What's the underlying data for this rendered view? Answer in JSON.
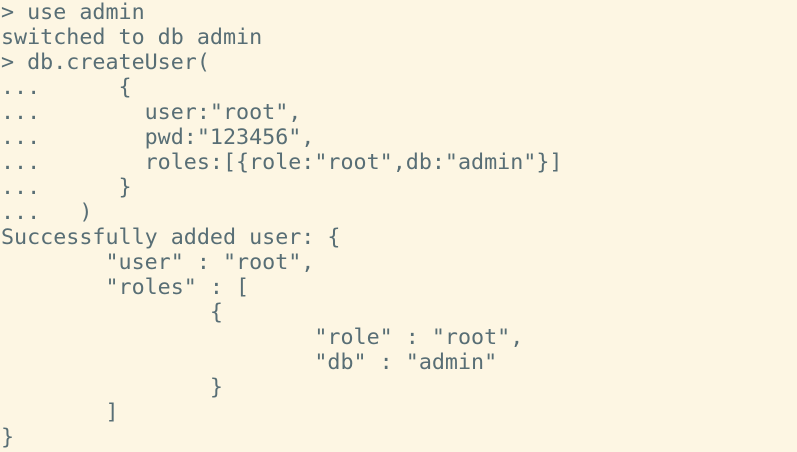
{
  "terminal": {
    "lines": [
      "> use admin",
      "switched to db admin",
      "> db.createUser(",
      "...      {",
      "...        user:\"root\",",
      "...        pwd:\"123456\",",
      "...        roles:[{role:\"root\",db:\"admin\"}]",
      "...      }",
      "...   )",
      "Successfully added user: {",
      "        \"user\" : \"root\",",
      "        \"roles\" : [",
      "                {",
      "                        \"role\" : \"root\",",
      "                        \"db\" : \"admin\"",
      "                }",
      "        ]",
      "}"
    ]
  }
}
